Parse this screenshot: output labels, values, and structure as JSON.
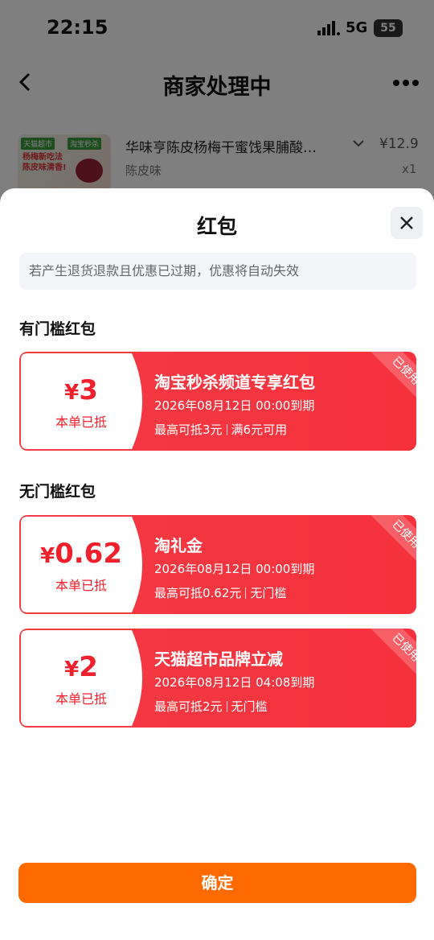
{
  "status_bar": {
    "time": "22:15",
    "network": "5G",
    "battery": "55"
  },
  "nav": {
    "title": "商家处理中"
  },
  "product": {
    "image_tag_1": "天猫超市",
    "image_tag_2": "淘宝秒杀",
    "image_slogan": "杨梅新吃法 陈皮味清香!",
    "name": "华味亨陈皮杨梅干蜜饯果脯酸…",
    "price": "¥12.9",
    "spec": "陈皮味",
    "quantity": "x1"
  },
  "sheet": {
    "title": "红包",
    "notice": "若产生退货退款且优惠已过期，优惠将自动失效",
    "sections": [
      {
        "title": "有门槛红包",
        "coupons": [
          {
            "symbol": "¥",
            "amount": "3",
            "status": "本单已抵",
            "name": "淘宝秒杀频道专享红包",
            "expiry": "2026年08月12日  00:00到期",
            "max": "最高可抵3元",
            "condition": "满6元可用",
            "badge": "已使用"
          }
        ]
      },
      {
        "title": "无门槛红包",
        "coupons": [
          {
            "symbol": "¥",
            "amount": "0.62",
            "status": "本单已抵",
            "name": "淘礼金",
            "expiry": "2026年08月12日  00:00到期",
            "max": "最高可抵0.62元",
            "condition": "无门槛",
            "badge": "已使用"
          },
          {
            "symbol": "¥",
            "amount": "2",
            "status": "本单已抵",
            "name": "天猫超市品牌立减",
            "expiry": "2026年08月12日  04:08到期",
            "max": "最高可抵2元",
            "condition": "无门槛",
            "badge": "已使用"
          }
        ]
      }
    ],
    "confirm_label": "确定"
  },
  "colors": {
    "coupon_red": "#f43a44",
    "confirm_orange": "#ff6a00",
    "amount_red": "#f0202c"
  }
}
